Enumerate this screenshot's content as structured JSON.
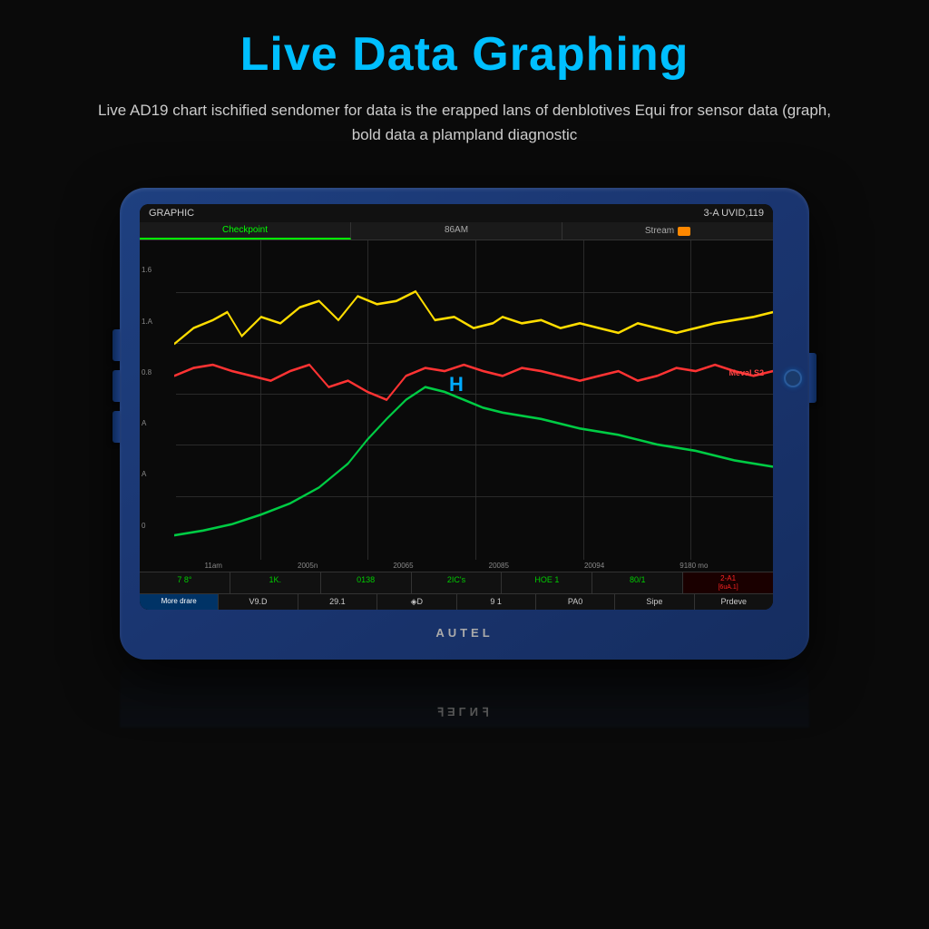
{
  "header": {
    "title": "Live Data Graphing",
    "subtitle": "Live AD19 chart ischified sendomer for data is the erapped lans of denblotives Equi fror sensor data (graph, bold data a plampland diagnostic"
  },
  "device": {
    "brand": "AUTEL",
    "screen": {
      "topbar": {
        "left": "GRAPHIC",
        "right": "3-A UVID,119"
      },
      "navtabs": [
        "Checkpoint",
        "86AM",
        "Stream"
      ],
      "y_labels": [
        "1.6",
        "1.A",
        "0.8",
        "A",
        "A",
        "0"
      ],
      "x_labels": [
        "11am",
        "2005n",
        "20065",
        "20085",
        "20094",
        "9180 mo"
      ],
      "legend": "Meval S2",
      "h_marker": "H",
      "btn_row1": [
        "7 8°",
        "1K.",
        "0138",
        "2IC's",
        "HOE1",
        "80/1",
        "2-A1"
      ],
      "btn_row2": [
        "More drare",
        "V9.D",
        "29.1",
        "◈D",
        "9 1",
        "PA0",
        "Sipe",
        "Prdeve"
      ]
    }
  },
  "chart": {
    "lines": {
      "yellow": "volatile high-frequency line around y=60-70%",
      "red": "mid-level fluctuating line around y=50-55%",
      "green": "rising curve from bottom-left to mid-right"
    }
  }
}
